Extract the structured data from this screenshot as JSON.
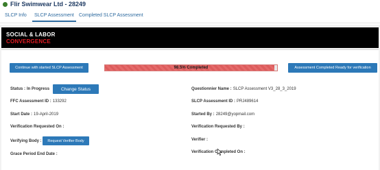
{
  "header": {
    "company_name": "Flir Swimwear Ltd - 28249",
    "status_dot_color": "#3a7d2b"
  },
  "tabs": [
    {
      "label": "SLCP Info",
      "active": false
    },
    {
      "label": "SLCP Assessment",
      "active": true
    },
    {
      "label": "Completed SLCP Assessment",
      "active": false
    }
  ],
  "banner": {
    "line1": "SOCIAL & LABOR",
    "line2": "CONVERGENCE",
    "line1_color": "#ffffff",
    "line2_color": "#e31b23"
  },
  "actions": {
    "continue_label": "Continue with started SLCP Assessment",
    "complete_label": "Assessment Completed Ready for verification"
  },
  "progress": {
    "percent": 98.5,
    "text": "98.5% Completed",
    "fill_color": "#e56a6a"
  },
  "left_fields": {
    "status_label": "Status :",
    "status_value": "In Progress",
    "change_status_label": "Change Status",
    "ffc_label": "FFC Assessment ID :",
    "ffc_value": "133292",
    "start_label": "Start Date :",
    "start_value": "19-April-2019",
    "verif_req_on_label": "Verification Requested On :",
    "verif_req_on_value": "",
    "verifying_body_label": "Verifying Body :",
    "request_verifier_label": "Request Verifier Body",
    "grace_label": "Grace Period End Date :",
    "grace_value": ""
  },
  "right_fields": {
    "questionnaire_label": "Questionnier Name :",
    "questionnaire_value": "SLCP Assessment V3_28_3_2019",
    "slcp_id_label": "SLCP Assessment ID :",
    "slcp_id_value": "PRJ489614",
    "started_by_label": "Started By :",
    "started_by_value": "28249@yopmail.com",
    "verif_req_by_label": "Verification Requested By :",
    "verif_req_by_value": "",
    "verifier_label": "Verifier :",
    "verifier_value": "",
    "verif_completed_label": "Verification Completed On :",
    "verif_completed_value": ""
  }
}
